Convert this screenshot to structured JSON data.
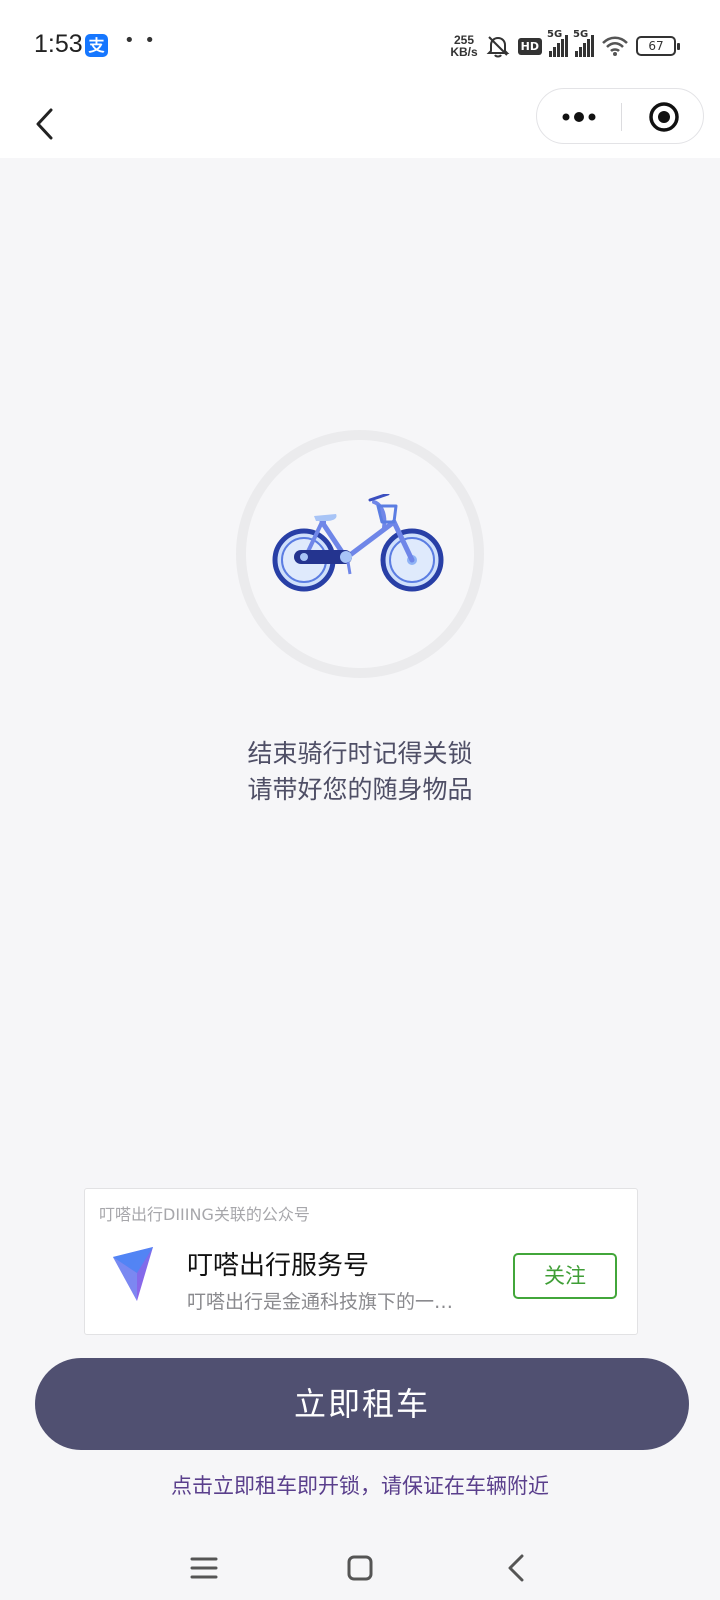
{
  "status_bar": {
    "time": "1:53",
    "app_icon_glyph": "支",
    "dots": "• •",
    "speed_value": "255",
    "speed_unit": "KB/s",
    "hd_label": "HD",
    "net1": "5G",
    "net2": "5G",
    "battery": "67"
  },
  "nav": {
    "back_icon": "chevron-left-icon",
    "more_icon": "more-dots-icon",
    "close_icon": "target-close-icon"
  },
  "main": {
    "illustration_icon": "bicycle-icon",
    "tip_line1": "结束骑行时记得关锁",
    "tip_line2": "请带好您的随身物品"
  },
  "official_account": {
    "header": "叮嗒出行DIIING关联的公众号",
    "name": "叮嗒出行服务号",
    "description": "叮嗒出行是金通科技旗下的一…",
    "follow_label": "关注",
    "logo_icon": "diiing-logo-icon"
  },
  "actions": {
    "rent_label": "立即租车",
    "rent_hint": "点击立即租车即开锁，请保证在车辆附近"
  },
  "system_nav": {
    "menu_icon": "menu-icon",
    "home_icon": "home-square-icon",
    "back_icon": "back-triangle-icon"
  },
  "colors": {
    "primary_button": "#505071",
    "follow_green": "#42a63a",
    "hint_purple": "#5a3f8c",
    "bike_blue": "#4a63d8",
    "background": "#f6f6f8"
  }
}
